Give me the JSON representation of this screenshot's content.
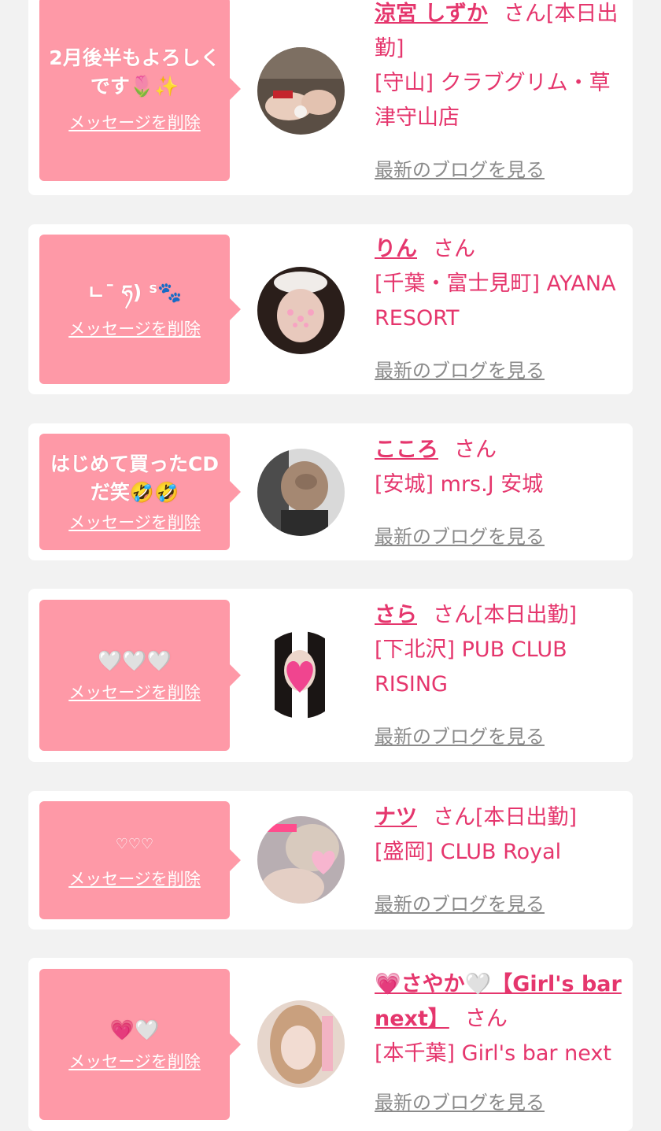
{
  "delete_label": "メッセージを削除",
  "blog_label": "最新のブログを見る",
  "san_label": "さん",
  "colors": {
    "pink_bubble": "#fe99a7",
    "name_pink": "#e5366d",
    "link_gray": "#8a8a8a",
    "page_bg": "#f2f2f2"
  },
  "items": [
    {
      "message": "2月後半もよろしくです🌷✨",
      "name": "涼宮 しずか",
      "status": "[本日出勤]",
      "shop": "[守山] クラブグリム・草津守山店",
      "avatar_icon": "girl-photo-avatar"
    },
    {
      "message": "ㄴ¯ ཧ) ᔆ🐾",
      "name": "りん",
      "status": "",
      "shop": "[千葉・富士見町] AYANA RESORT",
      "avatar_icon": "girl-photo-avatar"
    },
    {
      "message": "はじめて買ったCDだ笑🤣🤣",
      "name": "こころ",
      "status": "",
      "shop": "[安城] mrs.J 安城",
      "avatar_icon": "girl-photo-avatar"
    },
    {
      "message": "🤍🤍🤍",
      "name": "さら",
      "status": "[本日出勤]",
      "shop": "[下北沢] PUB CLUB RISING",
      "avatar_icon": "girl-photo-avatar"
    },
    {
      "message": "♡♡♡",
      "name": "ナツ",
      "status": "[本日出勤]",
      "shop": "[盛岡] CLUB Royal",
      "avatar_icon": "girl-photo-avatar"
    },
    {
      "message": "💗🤍",
      "name": "💗さやか🤍【Girl's bar next】",
      "status": "",
      "shop": "[本千葉] Girl's bar next",
      "avatar_icon": "girl-photo-avatar"
    }
  ]
}
